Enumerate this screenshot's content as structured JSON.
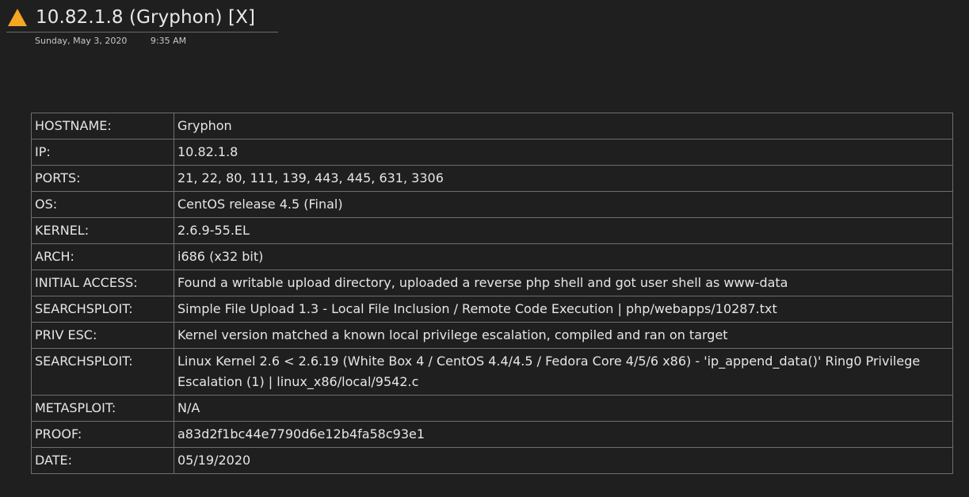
{
  "header": {
    "title": "10.82.1.8 (Gryphon) [X]",
    "date": "Sunday, May 3, 2020",
    "time": "9:35 AM",
    "icon": "warning-triangle-icon",
    "icon_color": "#f5a623"
  },
  "table": {
    "rows": [
      {
        "key": "HOSTNAME:",
        "value": "Gryphon"
      },
      {
        "key": "IP:",
        "value": "10.82.1.8"
      },
      {
        "key": "PORTS:",
        "value": "21, 22, 80, 111, 139, 443, 445, 631, 3306"
      },
      {
        "key": "OS:",
        "value": "CentOS release 4.5 (Final)"
      },
      {
        "key": "KERNEL:",
        "value": "2.6.9-55.EL"
      },
      {
        "key": "ARCH:",
        "value": "i686 (x32 bit)"
      },
      {
        "key": "INITIAL ACCESS:",
        "value": "Found a writable upload directory, uploaded a reverse php shell and got user shell as www-data"
      },
      {
        "key": "SEARCHSPLOIT:",
        "value": "Simple File Upload 1.3 - Local File Inclusion / Remote Code Execution  | php/webapps/10287.txt"
      },
      {
        "key": "PRIV ESC:",
        "value": "Kernel version matched a known local privilege escalation, compiled and ran on target"
      },
      {
        "key": "SEARCHSPLOIT:",
        "value": "Linux Kernel 2.6 < 2.6.19 (White Box 4 / CentOS 4.4/4.5 / Fedora Core 4/5/6 x86) - 'ip_append_data()' Ring0 Privilege Escalation (1)  | linux_x86/local/9542.c"
      },
      {
        "key": "METASPLOIT:",
        "value": "N/A"
      },
      {
        "key": "PROOF:",
        "value": "a83d2f1bc44e7790d6e12b4fa58c93e1"
      },
      {
        "key": "DATE:",
        "value": "05/19/2020"
      }
    ]
  }
}
